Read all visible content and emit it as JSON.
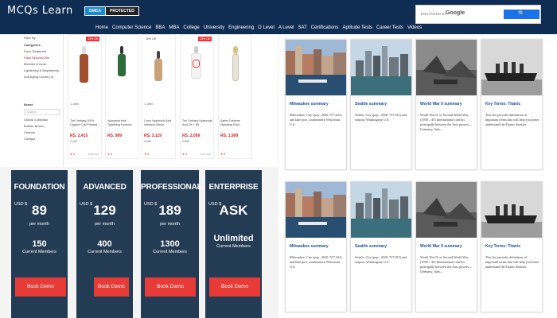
{
  "header": {
    "logo": "MCQs Learn",
    "badge_dmca": "DMCA",
    "badge_protected": "PROTECTED",
    "search_label": "ENHANCED BY",
    "search_brand": "Google",
    "search_button": "🔍",
    "nav": [
      "Home",
      "Computer Science",
      "BBA",
      "MBA",
      "College",
      "University",
      "Engineering",
      "O Level",
      "A Level",
      "SAT",
      "Certifications",
      "Aptitude Tests",
      "Career Tests",
      "Videos"
    ]
  },
  "shop": {
    "filters": [
      "Filter By",
      "Categories",
      "Face Treatment",
      "Face Serums/Oils",
      "Blemish & Acne...",
      "Lightening & Brightening...",
      "Anti Aging Cream (4)",
      "Brand",
      "Search",
      "Global Collection",
      "Bubble Brown",
      "Charms",
      "Clinique"
    ],
    "products": [
      {
        "offer": "1 offer",
        "name": "The Ordinary 100% Organic Cold Pressed...",
        "price": "RS. 2,415",
        "old": "2,700",
        "rating": "★ 5",
        "sold": "3248 Sold",
        "discount": "10% Off"
      },
      {
        "offer": "",
        "name": "Autopaste Hole Tightening Essence",
        "price": "RS. 999",
        "old": "",
        "rating": "★ 5",
        "sold": "",
        "discount": ""
      },
      {
        "offer": "1 offer",
        "name": "Cosrx Hyaluronic Acid Intensive Serum",
        "price": "RS. 3,119",
        "old": "3,495",
        "rating": "★ 5",
        "sold": "",
        "discount": "20% Off"
      },
      {
        "offer": "",
        "name": "The Ordinary Hyaluronic Acid 2% + B5",
        "price": "RS. 2,099",
        "old": "2,800",
        "rating": "★ 5",
        "sold": "2470 Sold",
        "discount": "25% Off"
      },
      {
        "offer": "",
        "name": "Safest Cetylene Hydrating Fluid...",
        "price": "RS. 1,999",
        "old": "",
        "rating": "★ 5",
        "sold": "",
        "discount": ""
      }
    ]
  },
  "pricing": [
    {
      "title": "FOUNDATION",
      "currency": "USD $",
      "amount": "89",
      "per": "per month",
      "members": "150",
      "members_label": "Current Members",
      "button": "Book Demo"
    },
    {
      "title": "ADVANCED",
      "currency": "USD $",
      "amount": "129",
      "per": "per month",
      "members": "400",
      "members_label": "Current Members",
      "button": "Book Demo"
    },
    {
      "title": "PROFESSIONAL",
      "currency": "USD $",
      "amount": "189",
      "per": "per month",
      "members": "1300",
      "members_label": "Current Members",
      "button": "Book Demo"
    },
    {
      "title": "ENTERPRISE",
      "currency": "USD $",
      "amount": "ASK",
      "per": "",
      "members": "Unlimited",
      "members_label": "Current Members",
      "button": "Book Demo"
    }
  ],
  "cards_top": [
    {
      "title": "Milwaukee summary",
      "desc": "Milwaukee, City (pop., 2020: 577,222) and lake port, southeastern Wisconsin, U.S."
    },
    {
      "title": "Seattle summary",
      "desc": "Seattle, City (pop., 2020: 737,015) and seaport, Washington, U.S."
    },
    {
      "title": "World War II summary",
      "desc": "World War II, or Second World War, (1939 – 45) International conflict principally between the Axis powers—Germany, Italy,..."
    },
    {
      "title": "Key Terms: Titanic",
      "desc": "This list provides definitions of important terms that will help you better understand the Titanic disaster."
    }
  ],
  "cards_bottom": [
    {
      "title": "Milwaukee summary",
      "desc": "Milwaukee, City (pop., 2020: 577,222) and lake port, southeastern Wisconsin, U.S."
    },
    {
      "title": "Seattle summary",
      "desc": "Seattle, City (pop., 2020: 737,015) and seaport, Washington, U.S."
    },
    {
      "title": "World War II summary",
      "desc": "World War II, or Second World War, (1939 – 45) International conflict principally between the Axis powers—Germany, Italy,..."
    },
    {
      "title": "Key Terms: Titanic",
      "desc": "This list provides definitions of important terms that will help you better understand the Titanic disaster."
    }
  ]
}
